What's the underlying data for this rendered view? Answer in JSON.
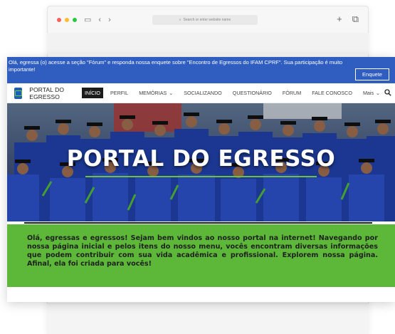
{
  "browser": {
    "url_placeholder": "Search or enter website name",
    "dot_colors": [
      "#ff5f57",
      "#febc2e",
      "#28c840"
    ],
    "tabs_icon": "sidebar-icon",
    "back_icon": "chevron-left-icon",
    "forward_icon": "chevron-right-icon",
    "new_tab_icon": "plus-icon",
    "tabs_overview_icon": "tabs-icon"
  },
  "announcement": {
    "text": "Olá, egressa (o) acesse a seção \"Fórum\" e responda nossa enquete sobre \"Encontro de Egressos do IFAM CPRF\". Sua participação é muito importante!",
    "button_label": "Enquete"
  },
  "site": {
    "title": "PORTAL DO EGRESSO",
    "nav": [
      {
        "label": "INÍCIO",
        "active": true
      },
      {
        "label": "PERFIL"
      },
      {
        "label": "MEMÓRIAS",
        "caret": "⌄"
      },
      {
        "label": "SOCIALIZANDO"
      },
      {
        "label": "QUESTIONÁRIO"
      },
      {
        "label": "FÓRUM"
      },
      {
        "label": "FALE CONOSCO"
      },
      {
        "label": "Mais",
        "caret": "⌄"
      }
    ],
    "search_icon": "search-icon"
  },
  "hero": {
    "title": "PORTAL DO EGRESSO",
    "accent_color": "#6ec23b"
  },
  "welcome": {
    "text": "Olá, egressas e egressos! Sejam bem vindos ao nosso portal na internet! Navegando por nossa página inicial e pelos itens do nosso menu, vocês encontram diversas informações que podem contribuir com sua vida acadêmica e profissional. Explorem nossa página. Afinal, ela foi criada para vocês!",
    "background": "#5db83a"
  }
}
